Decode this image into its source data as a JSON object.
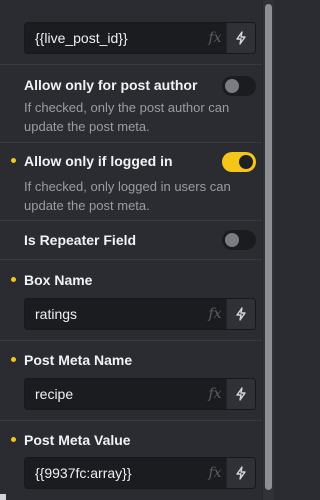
{
  "fields": {
    "post_id": {
      "value": "{{live_post_id}}",
      "fx": "fx"
    },
    "author": {
      "label": "Allow only for post author",
      "description": "If checked, only the post author can update the post meta.",
      "checked": false
    },
    "logged_in": {
      "label": "Allow only if logged in",
      "description": "If checked, only logged in users can update the post meta.",
      "checked": true
    },
    "repeater": {
      "label": "Is Repeater Field",
      "checked": false
    },
    "box_name": {
      "label": "Box Name",
      "value": "ratings",
      "fx": "fx"
    },
    "meta_name": {
      "label": "Post Meta Name",
      "value": "recipe",
      "fx": "fx"
    },
    "meta_value": {
      "label": "Post Meta Value",
      "value": "{{9937fc:array}}",
      "fx": "fx"
    }
  },
  "colors": {
    "accent": "#f5c518",
    "background": "#2b2c31",
    "input": "#1b1c20"
  },
  "icons": {
    "dynamic": "bolt-icon",
    "required": "dot-indicator"
  }
}
